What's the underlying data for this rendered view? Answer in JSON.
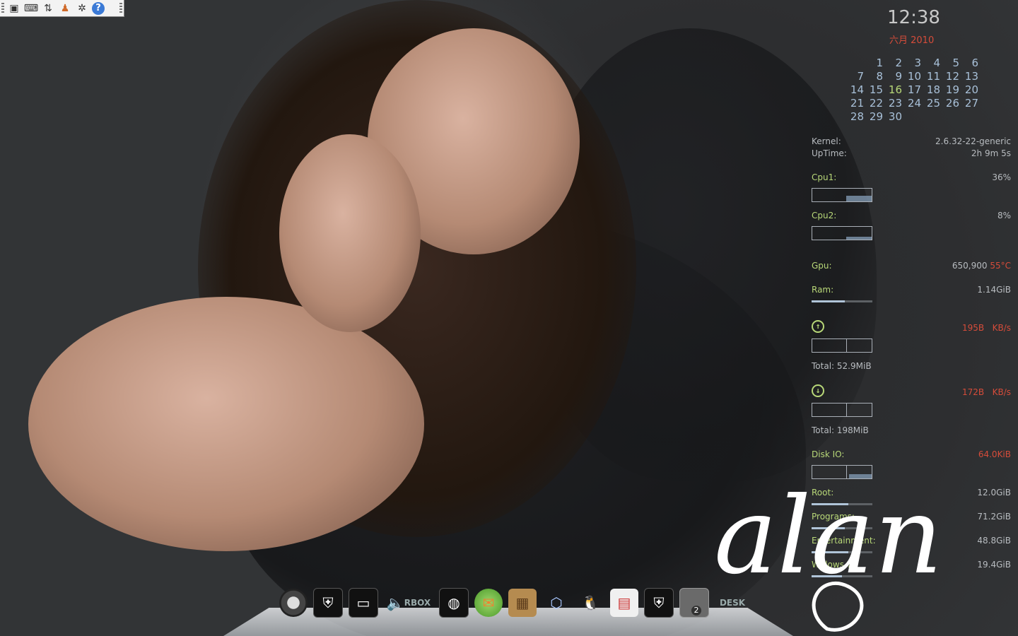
{
  "top_panel": {
    "icons": [
      "grip-handle-icon",
      "keypad-icon",
      "keyboard-icon",
      "network-transfer-icon",
      "user-icon",
      "system-gear-icon",
      "help-icon"
    ],
    "help_glyph": "?"
  },
  "conky": {
    "clock": "12:38",
    "month_year": "六月 2010",
    "calendar": [
      [
        "",
        "1",
        "2",
        "3",
        "4",
        "5",
        "6"
      ],
      [
        "7",
        "8",
        "9",
        "10",
        "11",
        "12",
        "13"
      ],
      [
        "14",
        "15",
        "16",
        "17",
        "18",
        "19",
        "20"
      ],
      [
        "21",
        "22",
        "23",
        "24",
        "25",
        "26",
        "27"
      ],
      [
        "28",
        "29",
        "30",
        "",
        "",
        "",
        ""
      ]
    ],
    "today": "16",
    "kernel_label": "Kernel:",
    "kernel_value": "2.6.32-22-generic",
    "uptime_label": "UpTime:",
    "uptime_value": "2h 9m 5s",
    "cpu1_label": "Cpu1:",
    "cpu1_value": "36%",
    "cpu2_label": "Cpu2:",
    "cpu2_value": "8%",
    "gpu_label": "Gpu:",
    "gpu_value": "650,900",
    "gpu_temp": "55°C",
    "ram_label": "Ram:",
    "ram_value": "1.14GiB",
    "ram_fraction": 0.55,
    "up_rate": "195B",
    "up_unit": "KB/s",
    "up_total_label": "Total:",
    "up_total": "52.9MiB",
    "down_rate": "172B",
    "down_unit": "KB/s",
    "down_total_label": "Total:",
    "down_total": "198MiB",
    "disk_io_label": "Disk IO:",
    "disk_io_value": "64.0KiB",
    "disks": [
      {
        "label": "Root:",
        "value": "12.0GiB",
        "fraction": 0.6
      },
      {
        "label": "Programs:",
        "value": "71.2GiB",
        "fraction": 0.55
      },
      {
        "label": "Entertainment:",
        "value": "48.8GiB",
        "fraction": 0.6
      },
      {
        "label": "Widows 7:",
        "value": "19.4GiB",
        "fraction": 0.5
      }
    ]
  },
  "signature_text": "alan",
  "dock": {
    "items": [
      {
        "name": "dock-item-system",
        "label": ""
      },
      {
        "name": "dock-item-shield",
        "label": ""
      },
      {
        "name": "dock-item-window",
        "label": ""
      },
      {
        "name": "dock-item-volume",
        "label": "RBOX"
      },
      {
        "name": "dock-item-browser",
        "label": ""
      },
      {
        "name": "dock-item-messenger",
        "label": ""
      },
      {
        "name": "dock-item-package",
        "label": ""
      },
      {
        "name": "dock-item-virtualbox",
        "label": ""
      },
      {
        "name": "dock-item-qq",
        "label": ""
      },
      {
        "name": "dock-item-calendar",
        "label": ""
      },
      {
        "name": "dock-item-shield2",
        "label": ""
      },
      {
        "name": "dock-item-desktop",
        "label": "2"
      }
    ],
    "desk_label": "DESK"
  },
  "colors": {
    "accent_green": "#b8d878",
    "accent_red": "#d64c3a",
    "text_gray": "#b8bcc0",
    "calendar_blue": "#a8c0d8"
  }
}
